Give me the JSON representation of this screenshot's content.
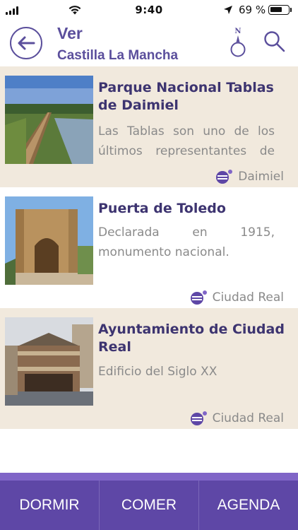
{
  "status_bar": {
    "time": "9:40",
    "battery_percent": "69 %",
    "battery_level": 0.69,
    "icons": [
      "signal-icon",
      "wifi-icon",
      "location-arrow-icon",
      "battery-icon"
    ]
  },
  "header": {
    "title": "Ver",
    "subtitle": "Castilla La Mancha",
    "icons": [
      "back-arrow-icon",
      "compass-north-icon",
      "search-icon"
    ],
    "compass_letter": "N"
  },
  "items": [
    {
      "title": "Parque Nacional Tablas de Daimiel",
      "description": "Las Tablas son uno de los últimos representantes de",
      "place": "Daimiel",
      "image": "wetland-boardwalk-photo"
    },
    {
      "title": "Puerta de Toledo",
      "description": "Declarada en 1915, monumento nacional.",
      "place": "Ciudad Real",
      "image": "stone-gate-photo"
    },
    {
      "title": "Ayuntamiento de Ciudad Real",
      "description": "Edificio del Siglo XX",
      "place": "Ciudad Real",
      "image": "town-hall-photo"
    }
  ],
  "bottom_nav": [
    "DORMIR",
    "COMER",
    "AGENDA"
  ],
  "colors": {
    "brand_purple": "#5b4f9c",
    "nav_purple": "#5e47a6",
    "accent_purple": "#8065c7",
    "card_beige": "#f1e9dd",
    "title_dark": "#3d3470",
    "muted_text": "#8a8a8a"
  }
}
